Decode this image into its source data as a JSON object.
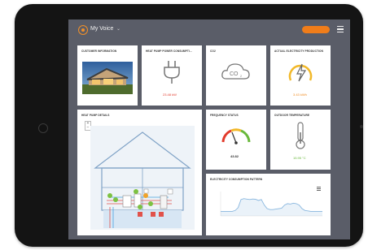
{
  "app": {
    "title": "My Voice",
    "chevron": "⌄",
    "primary_button": "",
    "menu_icon": "hamburger-icon"
  },
  "cards": {
    "customer": {
      "title": "CUSTOMER INFORMATION"
    },
    "heat_pump_consumption": {
      "title": "HEAT PUMP POWER CONSUMPTI...",
      "sub": "",
      "value": "23.48 kW",
      "icon": "plug-icon"
    },
    "co2": {
      "title": "CO2",
      "sub": "",
      "value": "",
      "icon": "cloud-co2-icon"
    },
    "production": {
      "title": "ACTUAL ELECTRICITY PRODUCTION",
      "value": "3.43 kWh",
      "icon": "lightning-gauge-icon"
    },
    "heat_pump_details": {
      "title": "HEAT PUMP DETAILS"
    },
    "frequency": {
      "title": "FREQUENCY STATUS",
      "value": "43.82",
      "icon": "gauge-icon"
    },
    "outdoor_temp": {
      "title": "OUTDOOR TEMPERATURE",
      "value": "15.95 °C",
      "icon": "thermometer-icon"
    },
    "electricity_chart": {
      "title": "ELECTRICITY CONSUMPTION PATTERN",
      "menu_icon": "chart-menu-icon"
    }
  },
  "colors": {
    "accent": "#f07d1a",
    "screen_bg": "#5a5d68",
    "alert": "#e23b2c",
    "ok": "#69b83b",
    "chart_line": "#89b7df"
  },
  "chart_data": {
    "type": "line",
    "title": "ELECTRICITY CONSUMPTION PATTERN",
    "xlabel": "",
    "ylabel": "",
    "x": [
      0,
      1,
      2,
      3,
      4,
      5,
      6,
      7,
      8,
      9,
      10,
      11,
      12,
      13,
      14,
      15,
      16,
      17,
      18,
      19,
      20,
      21,
      22,
      23,
      24,
      25,
      26,
      27,
      28,
      29,
      30,
      31,
      32,
      33,
      34,
      35
    ],
    "values": [
      5,
      5,
      5,
      5,
      5,
      6,
      9,
      18,
      19,
      18.5,
      18,
      18.6,
      18.3,
      17,
      18,
      12,
      8,
      7,
      7,
      7.5,
      8,
      8.5,
      12,
      13.5,
      13,
      14,
      13.5,
      12,
      8,
      6,
      5.5,
      5,
      5,
      5,
      5,
      5
    ],
    "ylim": [
      0,
      25
    ]
  }
}
